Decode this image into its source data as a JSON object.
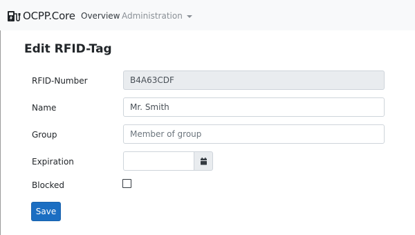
{
  "navbar": {
    "brand": "OCPP.Core",
    "brand_icon": "ev-charger-icon",
    "links": [
      {
        "label": "Overview"
      },
      {
        "label": "Administration",
        "dropdown": true
      }
    ]
  },
  "page": {
    "title": "Edit RFID-Tag"
  },
  "form": {
    "rfid_number": {
      "label": "RFID-Number",
      "value": "B4A63CDF",
      "disabled": true
    },
    "name": {
      "label": "Name",
      "value": "Mr. Smith"
    },
    "group": {
      "label": "Group",
      "value": "",
      "placeholder": "Member of group"
    },
    "expiration": {
      "label": "Expiration",
      "value": "",
      "button_icon": "calendar-icon"
    },
    "blocked": {
      "label": "Blocked",
      "checked": false
    },
    "save_label": "Save"
  },
  "colors": {
    "primary": "#1b6ec2",
    "navbar_bg": "#f8f9fa",
    "disabled_bg": "#e9ecef",
    "border": "#ced4da"
  }
}
